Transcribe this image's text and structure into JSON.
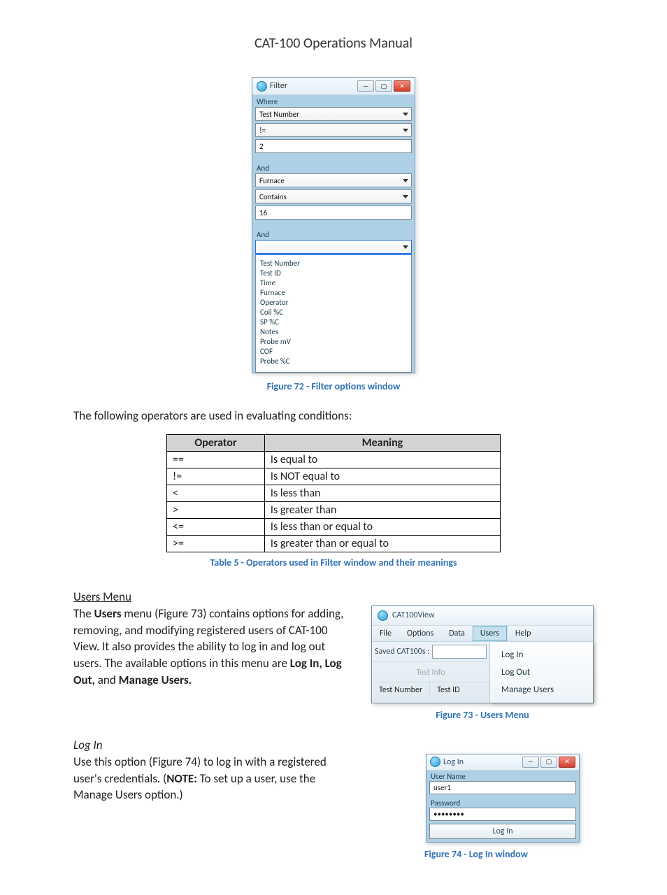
{
  "page_title": "CAT-100 Operations Manual",
  "fig72": {
    "window_title": "Filter",
    "where_label": "Where",
    "field1": "Test Number",
    "op1": "!=",
    "val1": "2",
    "and_label": "And",
    "field2": "Furnace",
    "op2": "Contains",
    "val2": "16",
    "and_label2": "And",
    "open_combo_value": "",
    "open_list": [
      "Test Number",
      "Test ID",
      "Time",
      "Furnace",
      "Operator",
      "Coil %C",
      "SP %C",
      "Notes",
      "Probe mV",
      "COF",
      "Probe %C"
    ],
    "caption": "Figure 72 - Filter options window"
  },
  "intro_para": "The following operators are used in evaluating conditions:",
  "op_table": {
    "headers": [
      "Operator",
      "Meaning"
    ],
    "rows": [
      [
        "==",
        "Is equal to"
      ],
      [
        "!=",
        "Is NOT equal to"
      ],
      [
        "<",
        "Is less than"
      ],
      [
        ">",
        "Is greater than"
      ],
      [
        "<=",
        "Is less than or equal to"
      ],
      [
        ">=",
        "Is greater than or equal to"
      ]
    ],
    "caption": "Table 5 - Operators used in Filter window and their meanings"
  },
  "users_section": {
    "heading": "Users Menu",
    "body_prefix": "The ",
    "bold1": "Users",
    "body_mid": " menu (Figure 73) contains options for adding, removing, and modifying registered users of CAT-100 View. It also provides the ability to log in and log out users. The available options in this menu are ",
    "bold2": "Log In, Log Out,",
    "body_mid2": " and ",
    "bold3": "Manage Users.",
    "body_suffix": ""
  },
  "fig73": {
    "app_title": "CAT100View",
    "menubar": [
      "File",
      "Options",
      "Data",
      "Users",
      "Help"
    ],
    "saved_label": "Saved CAT100s :",
    "test_info_label": "Test Info",
    "col1": "Test Number",
    "col2": "Test ID",
    "drop_items": [
      "Log In",
      "Log Out",
      "Manage Users"
    ],
    "caption": "Figure 73 - Users Menu"
  },
  "login_section": {
    "heading": "Log In",
    "body_prefix": "Use this option (Figure 74) to log in with a registered user's credentials. (",
    "note_bold": "NOTE:",
    "body_suffix": " To set up a user, use the Manage Users option.)"
  },
  "fig74": {
    "window_title": "Log In",
    "username_label": "User Name",
    "username_value": "user1",
    "password_label": "Password",
    "password_value": "••••••••",
    "login_btn": "Log In",
    "caption": "Figure 74 - Log In window"
  }
}
